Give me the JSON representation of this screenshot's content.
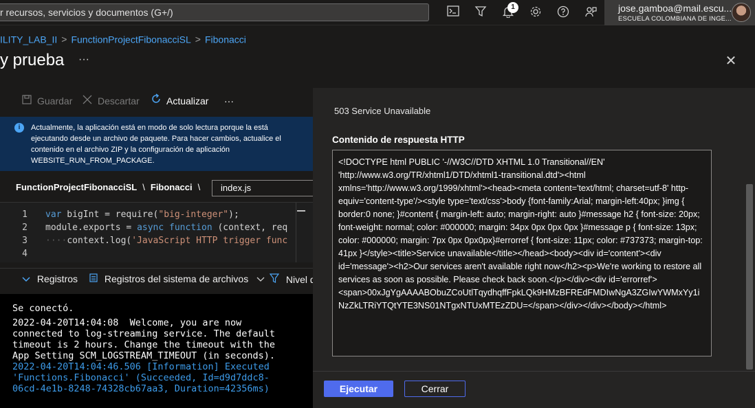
{
  "topbar": {
    "search_text": "r recursos, servicios y documentos (G+/)",
    "notification_count": "1",
    "account_name": "jose.gamboa@mail.escu...",
    "account_org": "ESCUELA COLOMBIANA DE INGE..."
  },
  "breadcrumb": {
    "item1": "ILITY_LAB_II",
    "item2": "FunctionProjectFibonacciSL",
    "item3": "Fibonacci",
    "separator": ">"
  },
  "page": {
    "title": "y prueba",
    "more": "···",
    "close": "✕"
  },
  "toolbar": {
    "save": "Guardar",
    "discard": "Descartar",
    "refresh": "Actualizar",
    "more": "···"
  },
  "infobar": {
    "text": "Actualmente, la aplicación está en modo de solo lectura porque la está ejecutando desde un archivo de paquete. Para hacer cambios, actualice el contenido en el archivo ZIP y la configuración de aplicación WEBSITE_RUN_FROM_PACKAGE."
  },
  "filepath": {
    "project": "FunctionProjectFibonacciSL",
    "function": "Fibonacci",
    "sep": "\\",
    "file": "index.js"
  },
  "editor": {
    "line_numbers": [
      "1",
      "2",
      "3",
      "4"
    ]
  },
  "logbar": {
    "logs": "Registros",
    "fs_logs": "Registros del sistema de archivos",
    "level": "Nivel d"
  },
  "console": {
    "line1": "Se conectó.",
    "line2": "2022-04-20T14:04:08  Welcome, you are now\nconnected to log-streaming service. The default\ntimeout is 2 hours. Change the timeout with the\nApp Setting SCM_LOGSTREAM_TIMEOUT (in seconds).",
    "line3": "2022-04-20T14:04:46.506 [Information] Executed\n'Functions.Fibonacci' (Succeeded, Id=d9d7ddc8-\n06cd-4e1b-8248-74328cb67aa3, Duration=42356ms)"
  },
  "response": {
    "status": "503 Service Unavailable",
    "label": "Contenido de respuesta HTTP",
    "body": "<!DOCTYPE html PUBLIC '-//W3C//DTD XHTML 1.0 Transitional//EN' 'http://www.w3.org/TR/xhtml1/DTD/xhtml1-transitional.dtd'><html xmlns='http://www.w3.org/1999/xhtml'><head><meta content='text/html; charset=utf-8' http-equiv='content-type'/><style type='text/css'>body {font-family:Arial; margin-left:40px; }img  { border:0 none; }#content { margin-left: auto; margin-right: auto }#message h2 { font-size: 20px; font-weight: normal; color: #000000; margin: 34px 0px 0px 0px }#message p  { font-size: 13px; color: #000000; margin: 7px 0px 0px0px}#errorref { font-size: 11px; color: #737373; margin-top: 41px }</style><title>Service unavailable</title></head><body><div id='content'><div id='message'><h2>Our services aren't available right now</h2><p>We're working to restore all services as soon as possible. Please check back soon.</p></div><div id='errorref'><span>00xJgYgAAAABObuZCoUtlTqydhqffFpkLQk9HMzBFREdFMDIwNgA3ZGIwYWMxYy1iNzZkLTRiYTQtYTE3NS01NTgxNTUxMTEzZDU=</span></div></div></body></html>"
  },
  "actions": {
    "run": "Ejecutar",
    "close": "Cerrar"
  }
}
